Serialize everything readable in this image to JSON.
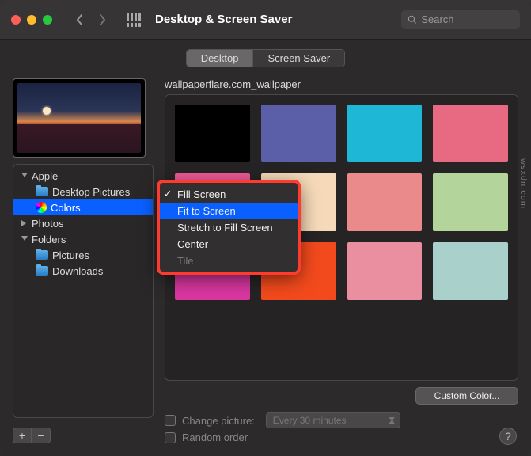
{
  "window": {
    "title": "Desktop & Screen Saver",
    "search_placeholder": "Search"
  },
  "tabs": {
    "desktop": "Desktop",
    "screensaver": "Screen Saver"
  },
  "wallpaper_name": "wallpaperflare.com_wallpaper",
  "dropdown": {
    "items": [
      {
        "label": "Fill Screen",
        "checked": true,
        "selected": false,
        "disabled": false
      },
      {
        "label": "Fit to Screen",
        "checked": false,
        "selected": true,
        "disabled": false
      },
      {
        "label": "Stretch to Fill Screen",
        "checked": false,
        "selected": false,
        "disabled": false
      },
      {
        "label": "Center",
        "checked": false,
        "selected": false,
        "disabled": false
      },
      {
        "label": "Tile",
        "checked": false,
        "selected": false,
        "disabled": true
      }
    ]
  },
  "sidebar": {
    "groups": [
      {
        "label": "Apple",
        "expanded": true,
        "children": [
          {
            "label": "Desktop Pictures",
            "icon": "folder",
            "selected": false
          },
          {
            "label": "Colors",
            "icon": "colors",
            "selected": true
          }
        ]
      },
      {
        "label": "Photos",
        "expanded": false,
        "children": []
      },
      {
        "label": "Folders",
        "expanded": true,
        "children": [
          {
            "label": "Pictures",
            "icon": "folder",
            "selected": false
          },
          {
            "label": "Downloads",
            "icon": "folder",
            "selected": false
          }
        ]
      }
    ],
    "add_btn": "+",
    "remove_btn": "−"
  },
  "colors": [
    "#000000",
    "#5a5fa8",
    "#1eb8d6",
    "#e76a82",
    "#ed5a97",
    "#f5d9b8",
    "#eb8a8a",
    "#b3d49a",
    "#d837a0",
    "#f24a1c",
    "#e98fa0",
    "#aad0cc"
  ],
  "custom_color_btn": "Custom Color...",
  "change_picture": {
    "label": "Change picture:",
    "interval": "Every 30 minutes"
  },
  "random_order_label": "Random order",
  "help": "?",
  "watermark": "wsxdn.com"
}
